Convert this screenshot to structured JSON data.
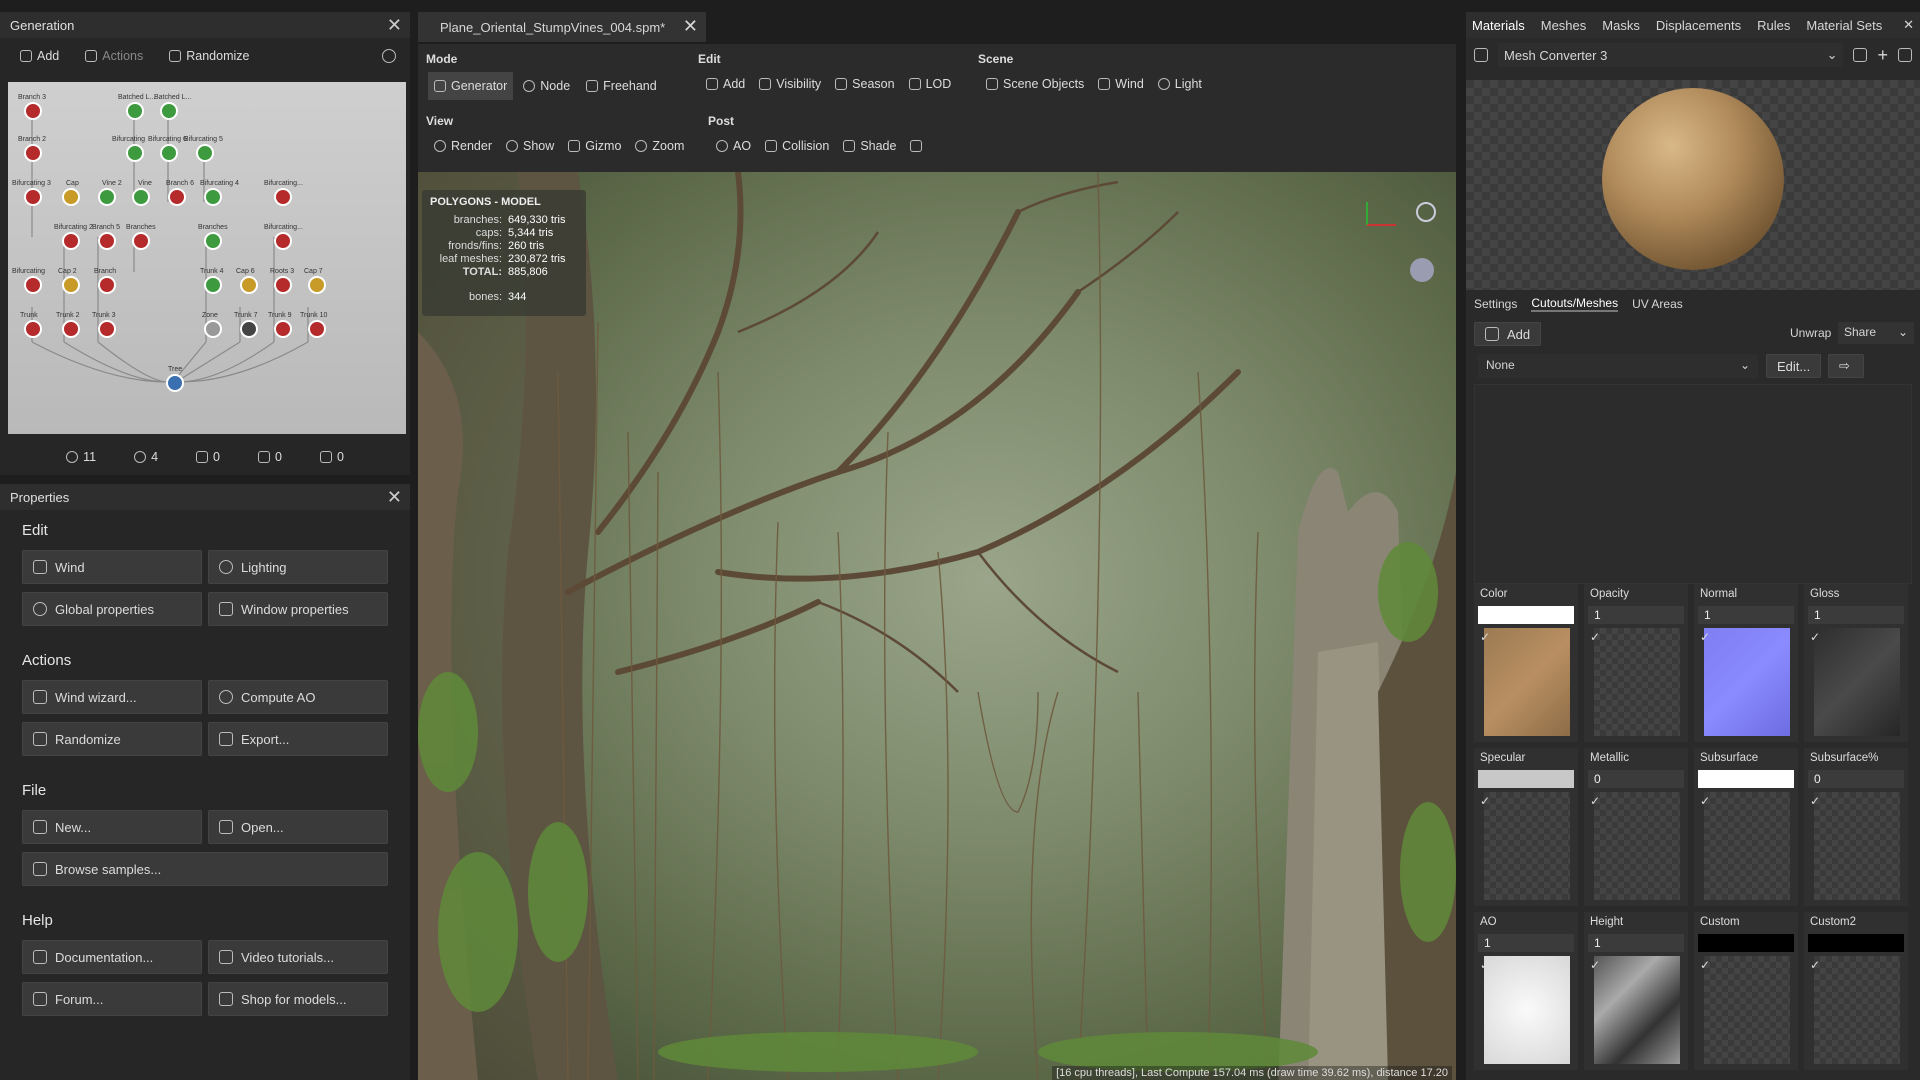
{
  "generation": {
    "title": "Generation",
    "toolbar": {
      "add": "Add",
      "actions": "Actions",
      "randomize": "Randomize"
    },
    "nodes": [
      "Branch 3",
      "Batched L...",
      "Batched L...",
      "Branch 2",
      "Bifurcating",
      "Bifurcating 6",
      "Bifurcating 5",
      "Batched L...",
      "Bifurcating 3",
      "Cap",
      "Vine 2",
      "Vine",
      "Branch 6",
      "Bifurcating 4",
      "Bifurcating...",
      "Bifurcating 2",
      "Branch 5",
      "Branches",
      "Branches",
      "Bifurcating...",
      "Bifurcating",
      "Cap 2",
      "Branch",
      "Trunk 4",
      "Cap 6",
      "Roots 3",
      "Cap 7",
      "Trunk",
      "Trunk 2",
      "Trunk 3",
      "Zone",
      "Trunk 7",
      "Trunk 9",
      "Trunk 10",
      "Tree"
    ],
    "stats": {
      "generators": "11",
      "materials": "4",
      "cameras": "0",
      "layers": "0",
      "paths": "0"
    }
  },
  "properties": {
    "title": "Properties",
    "edit": {
      "title": "Edit",
      "wind": "Wind",
      "lighting": "Lighting",
      "global": "Global properties",
      "window": "Window properties"
    },
    "actions": {
      "title": "Actions",
      "wind_wizard": "Wind wizard...",
      "compute_ao": "Compute AO",
      "randomize": "Randomize",
      "export": "Export..."
    },
    "file": {
      "title": "File",
      "new": "New...",
      "open": "Open...",
      "browse": "Browse samples..."
    },
    "help": {
      "title": "Help",
      "docs": "Documentation...",
      "videos": "Video tutorials...",
      "forum": "Forum...",
      "shop": "Shop for models..."
    }
  },
  "document": {
    "tab": "Plane_Oriental_StumpVines_004.spm*"
  },
  "toolbar": {
    "mode": {
      "label": "Mode",
      "generator": "Generator",
      "node": "Node",
      "freehand": "Freehand"
    },
    "edit": {
      "label": "Edit",
      "add": "Add",
      "visibility": "Visibility",
      "season": "Season",
      "lod": "LOD"
    },
    "scene": {
      "label": "Scene",
      "objects": "Scene Objects",
      "wind": "Wind",
      "light": "Light"
    },
    "view": {
      "label": "View",
      "render": "Render",
      "show": "Show",
      "gizmo": "Gizmo",
      "zoom": "Zoom"
    },
    "post": {
      "label": "Post",
      "ao": "AO",
      "collision": "Collision",
      "shade": "Shade"
    }
  },
  "stats_overlay": {
    "title": "POLYGONS - MODEL",
    "rows": [
      {
        "k": "branches:",
        "v": "649,330 tris"
      },
      {
        "k": "caps:",
        "v": "5,344 tris"
      },
      {
        "k": "fronds/fins:",
        "v": "260 tris"
      },
      {
        "k": "leaf meshes:",
        "v": "230,872 tris"
      },
      {
        "k": "TOTAL:",
        "v": "885,806"
      }
    ],
    "bones_k": "bones:",
    "bones_v": "344"
  },
  "status_bar": "[16 cpu threads], Last Compute 157.04 ms (draw time 39.62 ms), distance 17.20",
  "right_panel": {
    "tabs": [
      "Materials",
      "Meshes",
      "Masks",
      "Displacements",
      "Rules",
      "Material Sets"
    ],
    "material_name": "Mesh Converter 3",
    "sub_tabs": [
      "Settings",
      "Cutouts/Meshes",
      "UV Areas"
    ],
    "add": "Add",
    "unwrap": "Unwrap",
    "share": "Share",
    "dropdown": "None",
    "edit_btn": "Edit...",
    "slots": [
      {
        "label": "Color",
        "value": ""
      },
      {
        "label": "Opacity",
        "value": "1"
      },
      {
        "label": "Normal",
        "value": "1"
      },
      {
        "label": "Gloss",
        "value": "1"
      },
      {
        "label": "Specular",
        "value": ""
      },
      {
        "label": "Metallic",
        "value": "0"
      },
      {
        "label": "Subsurface",
        "value": ""
      },
      {
        "label": "Subsurface%",
        "value": "0"
      },
      {
        "label": "AO",
        "value": "1"
      },
      {
        "label": "Height",
        "value": "1"
      },
      {
        "label": "Custom",
        "value": ""
      },
      {
        "label": "Custom2",
        "value": ""
      }
    ]
  }
}
